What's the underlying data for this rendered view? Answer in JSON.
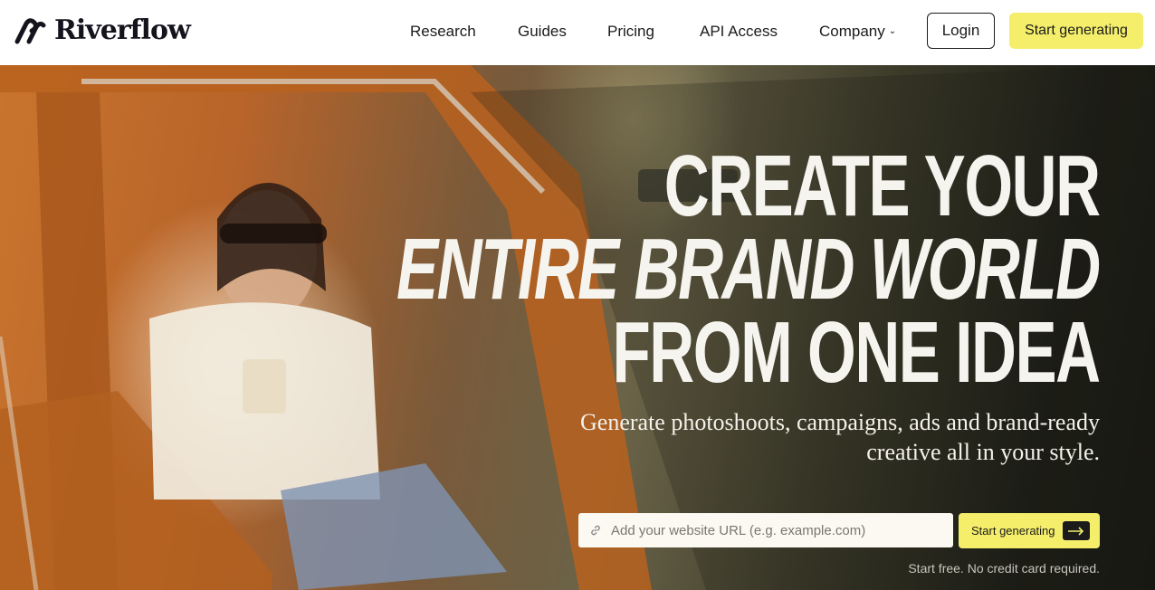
{
  "brand": {
    "name": "Riverflow",
    "logo_icon": "riverflow-logo-icon"
  },
  "nav": {
    "links": [
      "Research",
      "Guides",
      "Pricing",
      "API Access",
      "Company"
    ],
    "login_label": "Login",
    "cta_label": "Start generating"
  },
  "hero": {
    "headline": [
      "CREATE YOUR",
      "ENTIRE BRAND WORLD",
      "FROM ONE IDEA"
    ],
    "subtitle": [
      "Generate photoshoots, campaigns, ads and brand-ready",
      "creative all in your style."
    ],
    "url_placeholder": "Add your website URL (e.g. example.com)",
    "cta_label": "Start generating",
    "note": "Start free. No credit card required."
  },
  "colors": {
    "accent_yellow": "#f4ee6a",
    "text_dark": "#1b1b1b",
    "hero_text": "#f6f4ee"
  }
}
